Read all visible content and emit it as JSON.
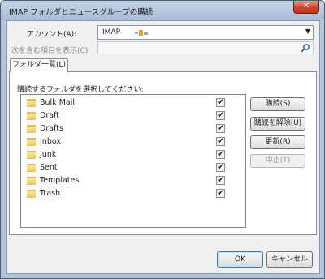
{
  "window": {
    "title": "IMAP フォルダとニュースグループの購読",
    "close_glyph": "✕"
  },
  "account": {
    "label": "アカウント(A):",
    "value": "IMAP-",
    "arrow": "▼",
    "color_bars": [
      "#7fb4e6",
      "#e8a33d",
      "#9aa7b5"
    ]
  },
  "search": {
    "label": "次を含む項目を表示(C):",
    "placeholder": "",
    "icon": "search-icon"
  },
  "tab": {
    "label": "フォルダ一覧(L)"
  },
  "panel": {
    "label": "購読するフォルダを選択してください:"
  },
  "folders": [
    {
      "name": "Bulk Mail",
      "checked": "✔"
    },
    {
      "name": "Draft",
      "checked": "✔"
    },
    {
      "name": "Drafts",
      "checked": "✔"
    },
    {
      "name": "Inbox",
      "checked": "✔"
    },
    {
      "name": "Junk",
      "checked": "✔"
    },
    {
      "name": "Sent",
      "checked": "✔"
    },
    {
      "name": "Templates",
      "checked": "✔"
    },
    {
      "name": "Trash",
      "checked": "✔"
    }
  ],
  "buttons": {
    "subscribe": "購読(S)",
    "unsubscribe": "購読を解除(U)",
    "refresh": "更新(R)",
    "stop": "中止(T)",
    "ok": "OK",
    "cancel": "キャンセル"
  }
}
